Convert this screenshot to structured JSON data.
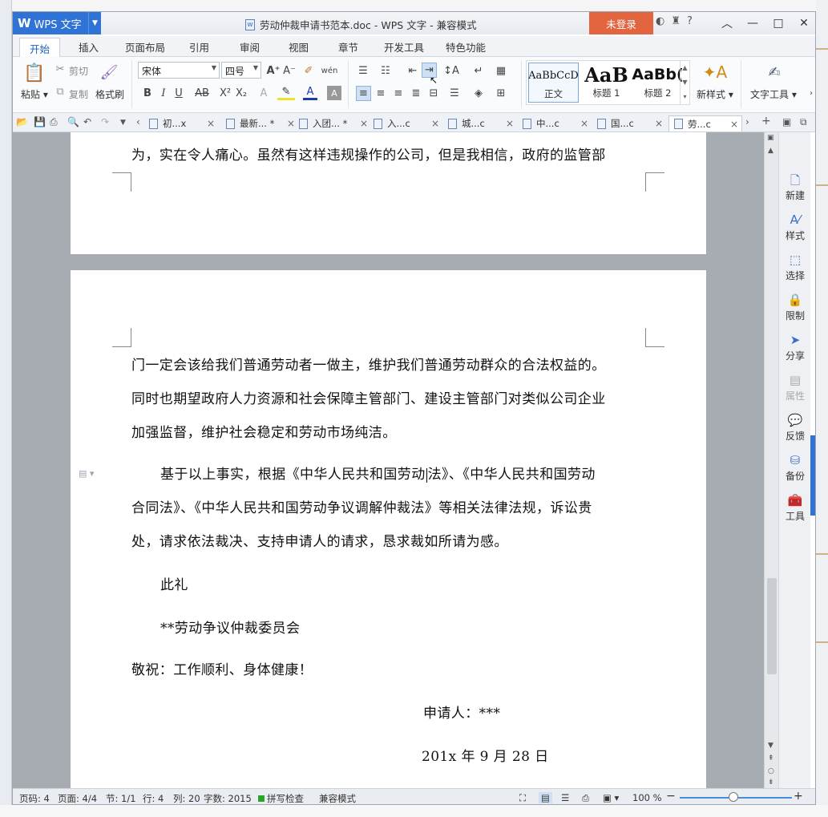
{
  "app": {
    "name": "WPS 文字",
    "title": "劳动仲裁申请书范本.doc - WPS 文字 - 兼容模式",
    "login_label": "未登录"
  },
  "menu_tabs": [
    "开始",
    "插入",
    "页面布局",
    "引用",
    "审阅",
    "视图",
    "章节",
    "开发工具",
    "特色功能"
  ],
  "ribbon": {
    "paste": "粘贴",
    "cut": "剪切",
    "copy": "复制",
    "format_painter": "格式刷",
    "font_name": "宋体",
    "font_size": "四号",
    "styles": [
      {
        "preview": "AaBbCcD",
        "label": "正文"
      },
      {
        "preview": "AaB",
        "label": "标题 1"
      },
      {
        "preview": "AaBb(",
        "label": "标题 2"
      }
    ],
    "new_style": "新样式",
    "text_tools": "文字工具"
  },
  "doc_tabs": [
    "初...x",
    "最新... *",
    "入团... *",
    "入...c",
    "城...c",
    "中...c",
    "国...c",
    "劳...c"
  ],
  "document": {
    "page1_line": "为，实在令人痛心。虽然有这样违规操作的公司，但是我相信，政府的监管部",
    "lines": [
      "门一定会该给我们普通劳动者一做主，维护我们普通劳动群众的合法权益的。",
      "同时也期望政府人力资源和社会保障主管部门、建设主管部门对类似公司企业",
      "加强监督，维护社会稳定和劳动市场纯洁。"
    ],
    "para2_a": "基于以上事实，根据《中华人民共和国劳动",
    "para2_b": "法》、《中华人民共和国劳动",
    "para2_lines": [
      "合同法》、《中华人民共和国劳动争议调解仲裁法》等相关法律法规，诉讼贵",
      "处，请求依法裁决、支持申请人的请求，恳求裁如所请为感。"
    ],
    "salutation": "此礼",
    "recipient": "**劳动争议仲裁委员会",
    "wishes": "敬祝：工作顺利、身体健康！",
    "applicant": "申请人：***",
    "date": "201x 年 9 月 28 日"
  },
  "right_pane": [
    "新建",
    "样式",
    "选择",
    "限制",
    "分享",
    "属性",
    "反馈",
    "备份",
    "工具"
  ],
  "status": {
    "page_no": "页码: 4",
    "pages": "页面: 4/4",
    "section": "节: 1/1",
    "row": "行: 4",
    "col": "列: 20",
    "words": "字数: 2015",
    "spell": "拼写检查",
    "mode": "兼容模式",
    "zoom": "100 %"
  },
  "colors": {
    "accent": "#2f73d6",
    "login": "#e2653f",
    "doc_bg": "#a7acb3"
  }
}
